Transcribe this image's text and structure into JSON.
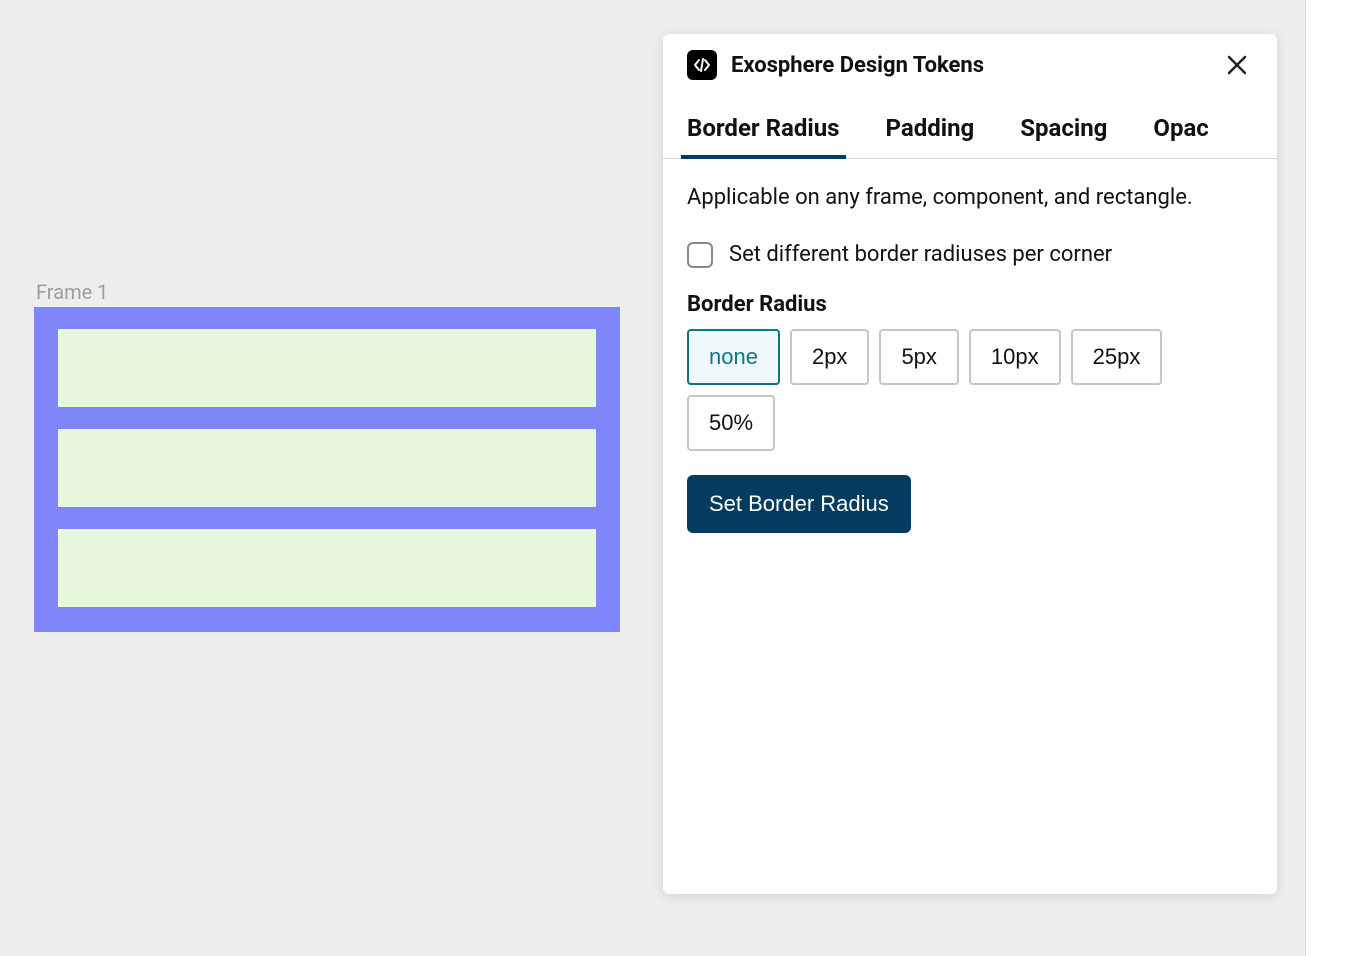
{
  "canvas": {
    "frame_label": "Frame 1"
  },
  "plugin": {
    "title": "Exosphere Design Tokens",
    "tabs": [
      {
        "label": "Border Radius",
        "active": true
      },
      {
        "label": "Padding",
        "active": false
      },
      {
        "label": "Spacing",
        "active": false
      },
      {
        "label": "Opac",
        "active": false
      }
    ],
    "description": "Applicable on any frame, component, and rectangle.",
    "checkbox_label": "Set different border radiuses per corner",
    "checkbox_checked": false,
    "section_label": "Border Radius",
    "radius_options": [
      {
        "label": "none",
        "selected": true
      },
      {
        "label": "2px",
        "selected": false
      },
      {
        "label": "5px",
        "selected": false
      },
      {
        "label": "10px",
        "selected": false
      },
      {
        "label": "25px",
        "selected": false
      },
      {
        "label": "50%",
        "selected": false
      }
    ],
    "apply_button": "Set Border Radius"
  },
  "colors": {
    "frame_bg": "#7e86f9",
    "frame_item_bg": "#e8f8df",
    "accent_teal": "#0d7680",
    "primary_dark": "#043c5f"
  }
}
